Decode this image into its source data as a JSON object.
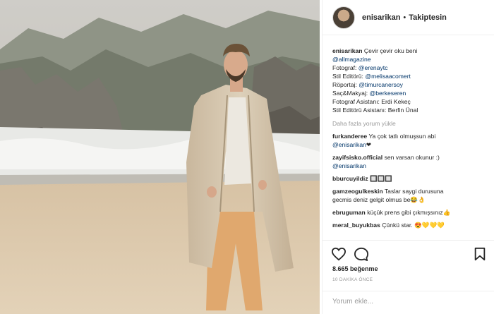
{
  "post": {
    "username": "enisarikan",
    "follow_status": "Takiptesin",
    "separator": "•"
  },
  "caption": {
    "username": "enisarikan",
    "text": "Çevir çevir oku beni",
    "lines": [
      {
        "prefix": "",
        "link": "@allmagazine"
      },
      {
        "prefix": "Fotograf: ",
        "link": "@erenaytc"
      },
      {
        "prefix": "Stil Editörü: ",
        "link": "@melisaacomert"
      },
      {
        "prefix": "Röportaj: ",
        "link": "@timurcanersoy"
      },
      {
        "prefix": "Saç&Makyaj: ",
        "link": "@berkeseren"
      },
      {
        "prefix": "Fotograf Asistanı: Erdi Kekeç",
        "link": ""
      },
      {
        "prefix": "Stil Editörü Asistanı: Berfin Ünal",
        "link": ""
      }
    ]
  },
  "load_more": "Daha fazla yorum yükle",
  "comments": [
    {
      "user": "furkanderee",
      "text": "Ya çok tatlı olmuşsun abi",
      "line2_link": "@enisarikan",
      "line2_text": "❤"
    },
    {
      "user": "zayifsisko.official",
      "text": "sen varsan okunur :)",
      "line2_link": "@enisarikan",
      "line2_text": ""
    },
    {
      "user": "bburcuyildiz",
      "text": "🔲🔲🔲",
      "line2_link": "",
      "line2_text": ""
    },
    {
      "user": "gamzeogulkeskin",
      "text": "Taslar saygi durusuna",
      "line2_link": "",
      "line2_text": "gecmis deniz gelgit olmus be😂👌"
    },
    {
      "user": "ebruguman",
      "text": "küçük prens gibi çıkmışsınız👍",
      "line2_link": "",
      "line2_text": ""
    },
    {
      "user": "meral_buyukbas",
      "text": "Çünkü star. 😍💛💛💛",
      "line2_link": "",
      "line2_text": ""
    }
  ],
  "icons": {
    "like": "heart-icon",
    "comment": "comment-icon",
    "save": "bookmark-icon"
  },
  "likes": "8.665 beğenme",
  "timestamp": "10 DAKİKA ÖNCE",
  "add_comment_placeholder": "Yorum ekle...",
  "colors": {
    "link": "#003569",
    "muted": "#999999",
    "text": "#262626",
    "border": "#efefef"
  }
}
